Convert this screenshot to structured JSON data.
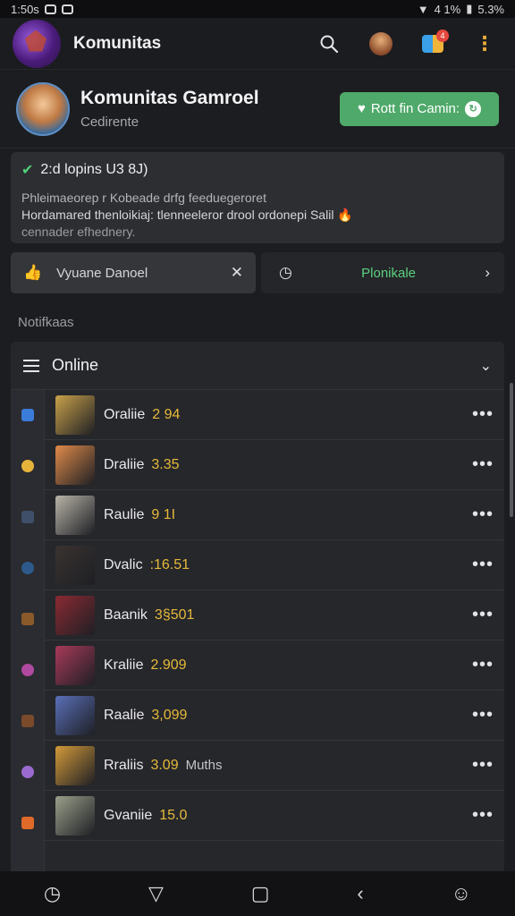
{
  "status_bar": {
    "time": "1:50s",
    "battery": "5.3%",
    "signal": "4 1%"
  },
  "app_bar": {
    "title": "Komunitas",
    "badge_count": "4"
  },
  "profile": {
    "name": "Komunitas Gamroel",
    "subtitle": "Cedirente",
    "button_label": "Rott fin Camin:"
  },
  "notice": {
    "title": "2:d  lopins U3 8J)",
    "line1": "Phleimaeorep r Kobeade drfg feeduegeroret",
    "line2": "Hordamared thenloikiaj: tlenneeleror drool ordonepi Salil",
    "line3": "cennader efhednery."
  },
  "actions": {
    "left_label": "Vyuane Danoel",
    "right_label": "Plonikale"
  },
  "section_label": "Notifkaas",
  "list": {
    "header_title": "Online",
    "rows": [
      {
        "name": "Oraliie",
        "value": "2 94",
        "extra": "",
        "thumb": "#c9a24a",
        "rail": "#3b7bd9"
      },
      {
        "name": "Draliie",
        "value": "3.35",
        "extra": "",
        "thumb": "#e08a4a",
        "rail": "#e6b43a"
      },
      {
        "name": "Raulie",
        "value": "9 1I",
        "extra": "",
        "thumb": "#b8b4a8",
        "rail": "#3f4f6a"
      },
      {
        "name": "Dvalic",
        "value": ":16.51",
        "extra": "",
        "thumb": "#3a3330",
        "rail": "#2d5a8a"
      },
      {
        "name": "Baanik",
        "value": "3§501",
        "extra": "",
        "thumb": "#8b2a32",
        "rail": "#8a5a2a"
      },
      {
        "name": "Kraliie",
        "value": "2.909",
        "extra": "",
        "thumb": "#a83a5a",
        "rail": "#b04aa0"
      },
      {
        "name": "Raalie",
        "value": "3,099",
        "extra": "",
        "thumb": "#5a6fb8",
        "rail": "#7a4a2a"
      },
      {
        "name": "Rraliis",
        "value": "3.09",
        "extra": "Muths",
        "thumb": "#d39a3a",
        "rail": "#9a6ad0"
      },
      {
        "name": "Gvaniie",
        "value": "15.0",
        "extra": "",
        "thumb": "#9aa08a",
        "rail": "#e06a2a"
      }
    ]
  },
  "nav": {
    "btn1": "◷",
    "btn2": "▽",
    "btn3": "▢",
    "btn4": "‹",
    "btn5": "☺"
  }
}
